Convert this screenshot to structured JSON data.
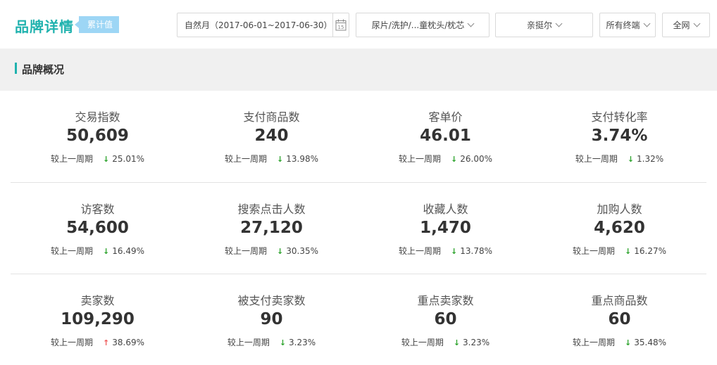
{
  "header": {
    "title": "品牌详情",
    "badge": "累计值",
    "date_range": "自然月（2017-06-01~2017-06-30）",
    "calendar_day": "15",
    "category": "尿片/洗护/...童枕头/枕芯",
    "brand": "亲挺尔",
    "terminal": "所有终端",
    "channel": "全网"
  },
  "section": {
    "title": "品牌概况"
  },
  "metrics": {
    "compare_label": "较上一周期",
    "rows": [
      [
        {
          "label": "交易指数",
          "value": "50,609",
          "change": "25.01%",
          "direction": "down"
        },
        {
          "label": "支付商品数",
          "value": "240",
          "change": "13.98%",
          "direction": "down"
        },
        {
          "label": "客单价",
          "value": "46.01",
          "change": "26.00%",
          "direction": "down"
        },
        {
          "label": "支付转化率",
          "value": "3.74%",
          "change": "1.32%",
          "direction": "down"
        }
      ],
      [
        {
          "label": "访客数",
          "value": "54,600",
          "change": "16.49%",
          "direction": "down"
        },
        {
          "label": "搜索点击人数",
          "value": "27,120",
          "change": "30.35%",
          "direction": "down"
        },
        {
          "label": "收藏人数",
          "value": "1,470",
          "change": "13.78%",
          "direction": "down"
        },
        {
          "label": "加购人数",
          "value": "4,620",
          "change": "16.27%",
          "direction": "down"
        }
      ],
      [
        {
          "label": "卖家数",
          "value": "109,290",
          "change": "38.69%",
          "direction": "up"
        },
        {
          "label": "被支付卖家数",
          "value": "90",
          "change": "3.23%",
          "direction": "down"
        },
        {
          "label": "重点卖家数",
          "value": "60",
          "change": "3.23%",
          "direction": "down"
        },
        {
          "label": "重点商品数",
          "value": "60",
          "change": "35.48%",
          "direction": "down"
        }
      ]
    ]
  },
  "colors": {
    "accent": "#1fb2ae",
    "badge": "#9dd6f5",
    "down": "#2da32d",
    "up": "#ef5b5b"
  }
}
